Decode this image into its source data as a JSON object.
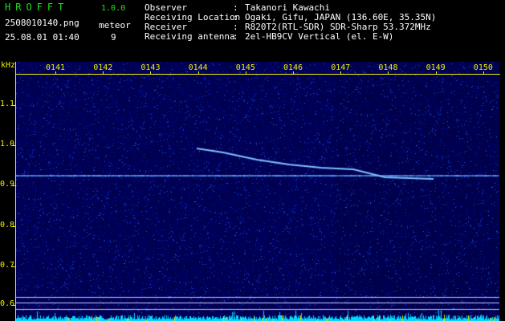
{
  "app": {
    "name": "HROFFT",
    "version": "1.0.0"
  },
  "file": {
    "name": "2508010140.png",
    "datetime": "25.08.01 01:40"
  },
  "meteor": {
    "label": "meteor",
    "count": "9"
  },
  "info": [
    {
      "label": "Observer",
      "value": "Takanori Kawachi"
    },
    {
      "label": "Receiving Location",
      "value": "Ogaki, Gifu, JAPAN (136.60E, 35.35N)"
    },
    {
      "label": "Receiver",
      "value": "R820T2(RTL-SDR) SDR-Sharp 53.372MHz"
    },
    {
      "label": "Receiving antenna",
      "value": "2el-HB9CV Vertical (el. E-W)"
    }
  ],
  "spectrogram": {
    "y_unit": "kHz",
    "y_ticks": [
      "1.1",
      "1.0",
      "0.9",
      "0.8",
      "0.7",
      "0.6"
    ],
    "time_ticks": [
      "0141",
      "0142",
      "0143",
      "0144",
      "0145",
      "0146",
      "0147",
      "0148",
      "0149",
      "0150"
    ],
    "colors": {
      "background": "#00005a",
      "trace": "#6fb6ff",
      "label": "#f0f000",
      "baseline": "#00e0ff"
    }
  }
}
